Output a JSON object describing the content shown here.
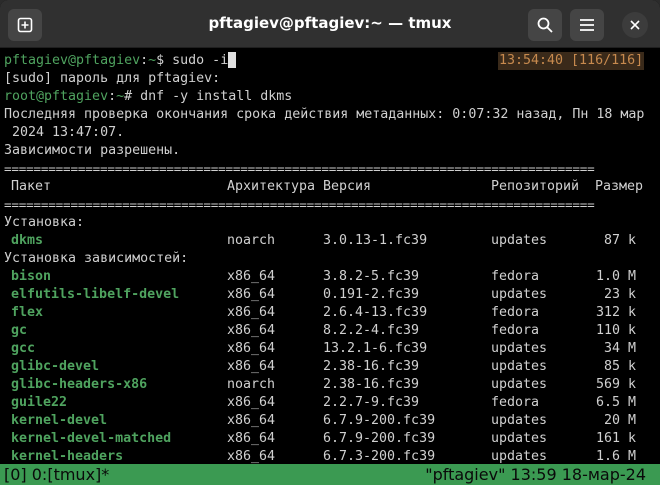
{
  "window": {
    "title": "pftagiev@pftagiev:~ — tmux"
  },
  "prompt1": {
    "user": "pftagiev@pftagiev",
    "sep": ":",
    "path": "~",
    "symbol": "$",
    "command": "sudo -i"
  },
  "clock": "13:54:40 [116/116]",
  "sudo_line": "[sudo] пароль для pftagiev:",
  "prompt2": {
    "user": "root@pftagiev",
    "sep": ":",
    "path": "~",
    "symbol": "#",
    "command": "dnf -y install dkms"
  },
  "meta_line1": "Последняя проверка окончания срока действия метаданных: 0:07:32 назад, Пн 18 мар",
  "meta_line2": " 2024 13:47:07.",
  "deps_resolved": "Зависимости разрешены.",
  "separator": "================================================================================",
  "columns": {
    "package": "Пакет",
    "arch": "Архитектура",
    "version": "Версия",
    "repo": "Репозиторий",
    "size": "Размер"
  },
  "section_install": "Установка:",
  "section_deps": "Установка зависимостей:",
  "install_rows": [
    {
      "name": "dkms",
      "arch": "noarch",
      "version": "3.0.13-1.fc39",
      "repo": "updates",
      "size": "87 k"
    }
  ],
  "dep_rows": [
    {
      "name": "bison",
      "arch": "x86_64",
      "version": "3.8.2-5.fc39",
      "repo": "fedora",
      "size": "1.0 M"
    },
    {
      "name": "elfutils-libelf-devel",
      "arch": "x86_64",
      "version": "0.191-2.fc39",
      "repo": "updates",
      "size": "23 k"
    },
    {
      "name": "flex",
      "arch": "x86_64",
      "version": "2.6.4-13.fc39",
      "repo": "fedora",
      "size": "312 k"
    },
    {
      "name": "gc",
      "arch": "x86_64",
      "version": "8.2.2-4.fc39",
      "repo": "fedora",
      "size": "110 k"
    },
    {
      "name": "gcc",
      "arch": "x86_64",
      "version": "13.2.1-6.fc39",
      "repo": "updates",
      "size": "34 M"
    },
    {
      "name": "glibc-devel",
      "arch": "x86_64",
      "version": "2.38-16.fc39",
      "repo": "updates",
      "size": "85 k"
    },
    {
      "name": "glibc-headers-x86",
      "arch": "noarch",
      "version": "2.38-16.fc39",
      "repo": "updates",
      "size": "569 k"
    },
    {
      "name": "guile22",
      "arch": "x86_64",
      "version": "2.2.7-9.fc39",
      "repo": "fedora",
      "size": "6.5 M"
    },
    {
      "name": "kernel-devel",
      "arch": "x86_64",
      "version": "6.7.9-200.fc39",
      "repo": "updates",
      "size": "20 M"
    },
    {
      "name": "kernel-devel-matched",
      "arch": "x86_64",
      "version": "6.7.9-200.fc39",
      "repo": "updates",
      "size": "161 k"
    },
    {
      "name": "kernel-headers",
      "arch": "x86_64",
      "version": "6.7.3-200.fc39",
      "repo": "updates",
      "size": "1.6 M"
    }
  ],
  "status": {
    "left": "[0] 0:[tmux]*",
    "right": "\"pftagiev\" 13:59 18-мар-24"
  },
  "colors": {
    "status_bg": "#3b9a52",
    "prompt_green": "#4fa35f",
    "titlebar": "#303030"
  },
  "icons": {
    "newtab": "new-tab-icon",
    "search": "search-icon",
    "menu": "hamburger-menu-icon",
    "close": "close-icon"
  }
}
